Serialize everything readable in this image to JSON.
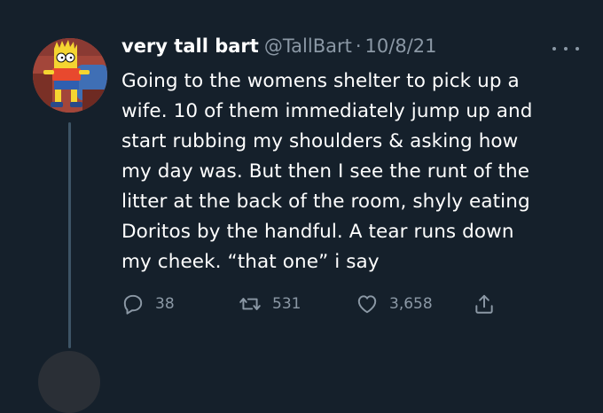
{
  "tweet": {
    "name": "very tall bart",
    "handle": "@TallBart",
    "separator": "·",
    "date": "10/8/21",
    "text_lines": [
      "Going to the womens shelter to pick up a",
      "wife. 10 of them immediately jump up and",
      "start rubbing my shoulders & asking how",
      "my day was. But then I see the runt of the",
      "litter at the back of the room, shyly eating",
      "Doritos by the handful. A tear runs down",
      "my cheek. “that one” i say"
    ],
    "reply_count": "38",
    "retweet_count": "531",
    "like_count": "3,658"
  },
  "icons": {
    "more": "more-horizontal-icon",
    "reply": "reply-icon",
    "retweet": "retweet-icon",
    "like": "heart-icon",
    "share": "share-icon"
  },
  "colors": {
    "background": "#15202b",
    "text_primary": "#ffffff",
    "text_secondary": "#8b98a5",
    "thread_line": "#3d5466"
  }
}
